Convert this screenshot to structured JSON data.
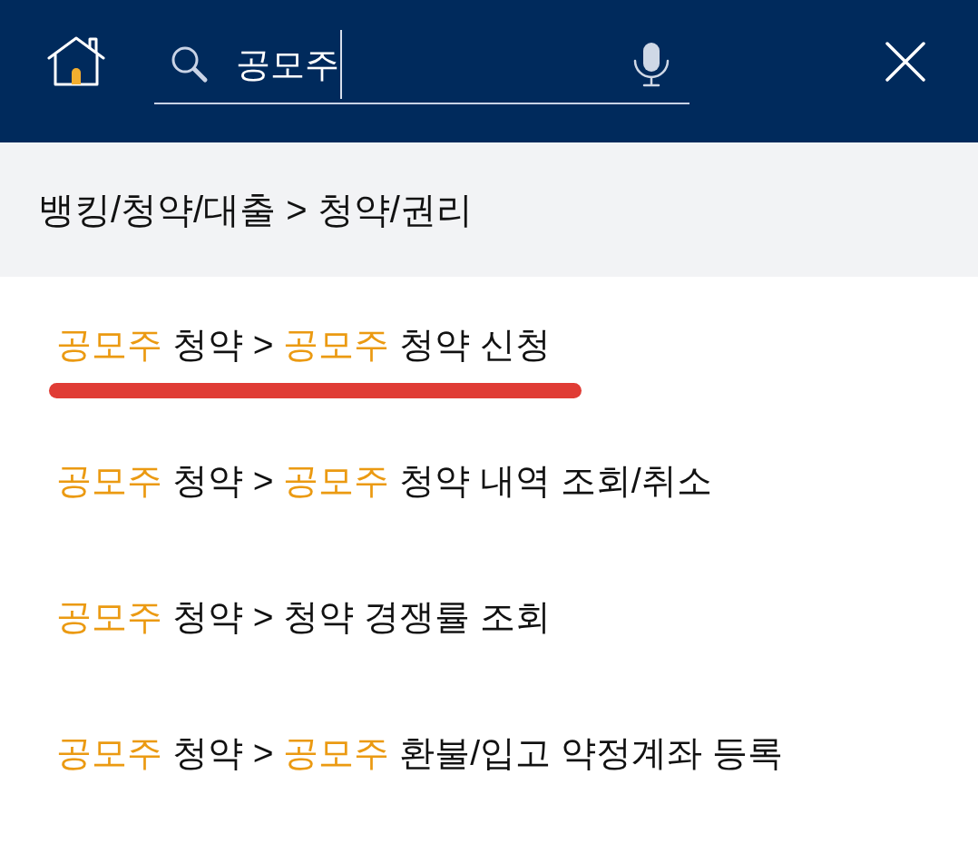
{
  "search": {
    "value": "공모주",
    "focused": true
  },
  "breadcrumb": "뱅킹/청약/대출 > 청약/권리",
  "results": [
    {
      "marked": true,
      "segments": [
        {
          "text": "공모주",
          "highlight": true
        },
        {
          "text": " 청약 > ",
          "highlight": false
        },
        {
          "text": "공모주",
          "highlight": true
        },
        {
          "text": " 청약 신청",
          "highlight": false
        }
      ]
    },
    {
      "marked": false,
      "segments": [
        {
          "text": "공모주",
          "highlight": true
        },
        {
          "text": " 청약 > ",
          "highlight": false
        },
        {
          "text": "공모주",
          "highlight": true
        },
        {
          "text": " 청약 내역 조회/취소",
          "highlight": false
        }
      ]
    },
    {
      "marked": false,
      "segments": [
        {
          "text": "공모주",
          "highlight": true
        },
        {
          "text": " 청약 > 청약 경쟁률 조회",
          "highlight": false
        }
      ]
    },
    {
      "marked": false,
      "segments": [
        {
          "text": "공모주",
          "highlight": true
        },
        {
          "text": " 청약 > ",
          "highlight": false
        },
        {
          "text": "공모주",
          "highlight": true
        },
        {
          "text": " 환불/입고 약정계좌 등록",
          "highlight": false
        }
      ]
    }
  ]
}
